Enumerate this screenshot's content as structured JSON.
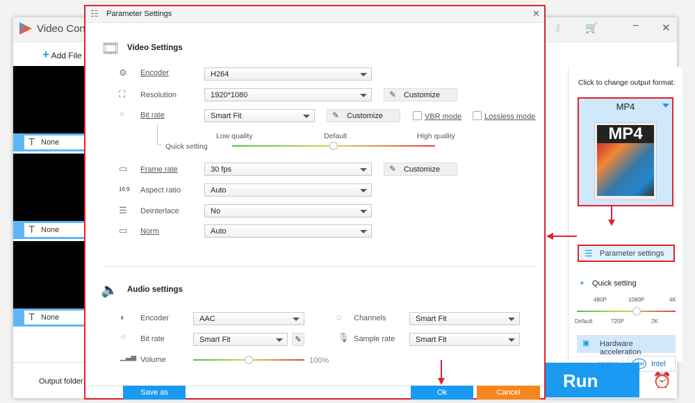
{
  "app": {
    "title": "Video Conv",
    "add_files": "Add File",
    "items": [
      {
        "subtitle": "None"
      },
      {
        "subtitle": "None"
      },
      {
        "subtitle": "None"
      }
    ],
    "output_folder_label": "Output folder:",
    "run_label": "Run"
  },
  "right_panel": {
    "format_prompt": "Click to change output format:",
    "format": "MP4",
    "format_icon_text": "MP4",
    "parameter_settings": "Parameter settings",
    "quick_setting": "Quick setting",
    "quality_top": [
      "480P",
      "1080P",
      "4K"
    ],
    "quality_bottom": [
      "Default",
      "720P",
      "2K"
    ],
    "quality_level": "1080P",
    "hardware_acceleration": "Hardware acceleration",
    "nvidia": "NVIDIA",
    "intel": "Intel"
  },
  "dialog": {
    "title": "Parameter Settings",
    "video": {
      "heading": "Video Settings",
      "encoder": {
        "label": "Encoder",
        "value": "H264"
      },
      "resolution": {
        "label": "Resolution",
        "value": "1920*1080",
        "customize": "Customize"
      },
      "bitrate": {
        "label": "Bit rate",
        "value": "Smart Fit",
        "customize": "Customize",
        "vbr": "VBR mode",
        "lossless": "Lossless mode",
        "vbr_checked": false,
        "lossless_checked": false
      },
      "quick": {
        "label": "Quick setting",
        "low": "Low quality",
        "default": "Default",
        "high": "High quality",
        "level_percent": 50
      },
      "framerate": {
        "label": "Frame rate",
        "value": "30 fps",
        "customize": "Customize"
      },
      "aspect": {
        "label": "Aspect ratio",
        "value": "Auto",
        "icon_text": "16:9"
      },
      "deinterlace": {
        "label": "Deinterlace",
        "value": "No"
      },
      "norm": {
        "label": "Norm",
        "value": "Auto"
      }
    },
    "audio": {
      "heading": "Audio settings",
      "encoder": {
        "label": "Encoder",
        "value": "AAC"
      },
      "channels": {
        "label": "Channels",
        "value": "Smart Fit"
      },
      "bitrate": {
        "label": "Bit rate",
        "value": "Smart Fit"
      },
      "samplerate": {
        "label": "Sample rate",
        "value": "Smart Fit"
      },
      "volume": {
        "label": "Volume",
        "value": "100%",
        "level_percent": 50
      }
    },
    "save_as": "Save as",
    "ok": "Ok",
    "cancel": "Cancel"
  },
  "colors": {
    "accent": "#1a9af0",
    "cancel": "#f7861e",
    "highlight": "#e0202a"
  }
}
